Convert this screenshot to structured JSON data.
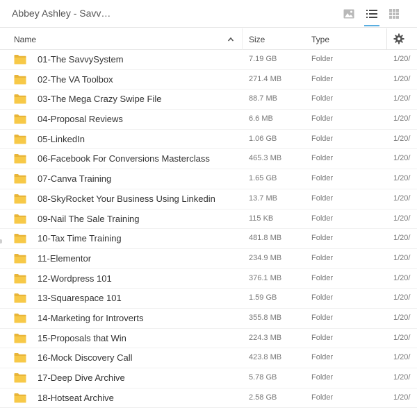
{
  "breadcrumb": "Abbey Ashley - Savv…",
  "toolbar": {
    "icons": [
      "thumbnail-view-icon",
      "list-view-icon",
      "grid-view-icon"
    ],
    "active_view": "list"
  },
  "columns": {
    "name": "Name",
    "size": "Size",
    "type": "Type"
  },
  "colors": {
    "folder": "#f7c948",
    "folder_dark": "#e8b53a",
    "active_underline": "#5aaee0"
  },
  "rows": [
    {
      "name": "01-The SavvySystem",
      "size": "7.19 GB",
      "type": "Folder",
      "date": "1/20/"
    },
    {
      "name": "02-The VA Toolbox",
      "size": "271.4 MB",
      "type": "Folder",
      "date": "1/20/"
    },
    {
      "name": "03-The Mega Crazy Swipe File",
      "size": "88.7 MB",
      "type": "Folder",
      "date": "1/20/"
    },
    {
      "name": "04-Proposal Reviews",
      "size": "6.6 MB",
      "type": "Folder",
      "date": "1/20/"
    },
    {
      "name": "05-LinkedIn",
      "size": "1.06 GB",
      "type": "Folder",
      "date": "1/20/"
    },
    {
      "name": "06-Facebook For Conversions Masterclass",
      "size": "465.3 MB",
      "type": "Folder",
      "date": "1/20/"
    },
    {
      "name": "07-Canva Training",
      "size": "1.65 GB",
      "type": "Folder",
      "date": "1/20/"
    },
    {
      "name": "08-SkyRocket Your Business Using Linkedin",
      "size": "13.7 MB",
      "type": "Folder",
      "date": "1/20/"
    },
    {
      "name": "09-Nail The Sale Training",
      "size": "115 KB",
      "type": "Folder",
      "date": "1/20/"
    },
    {
      "name": "10-Tax Time Training",
      "size": "481.8 MB",
      "type": "Folder",
      "date": "1/20/"
    },
    {
      "name": "11-Elementor",
      "size": "234.9 MB",
      "type": "Folder",
      "date": "1/20/"
    },
    {
      "name": "12-Wordpress 101",
      "size": "376.1 MB",
      "type": "Folder",
      "date": "1/20/"
    },
    {
      "name": "13-Squarespace 101",
      "size": "1.59 GB",
      "type": "Folder",
      "date": "1/20/"
    },
    {
      "name": "14-Marketing for Introverts",
      "size": "355.8 MB",
      "type": "Folder",
      "date": "1/20/"
    },
    {
      "name": "15-Proposals that Win",
      "size": "224.3 MB",
      "type": "Folder",
      "date": "1/20/"
    },
    {
      "name": "16-Mock Discovery Call",
      "size": "423.8 MB",
      "type": "Folder",
      "date": "1/20/"
    },
    {
      "name": "17-Deep Dive Archive",
      "size": "5.78 GB",
      "type": "Folder",
      "date": "1/20/"
    },
    {
      "name": "18-Hotseat Archive",
      "size": "2.58 GB",
      "type": "Folder",
      "date": "1/20/"
    }
  ]
}
